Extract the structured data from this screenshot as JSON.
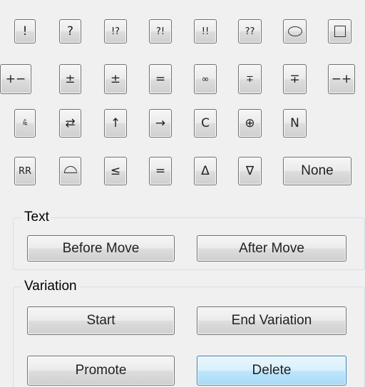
{
  "annotation_buttons": {
    "row1": [
      "!",
      "?",
      "!?",
      "?!",
      "!!",
      "??",
      "circle",
      "square"
    ],
    "row2": [
      "+−",
      "±",
      "±",
      "=",
      "∞",
      "∓",
      "∓",
      "−+"
    ],
    "row3": [
      "⩯",
      "⇄",
      "↑",
      "→",
      "C",
      "⊕",
      "N"
    ],
    "row4": [
      "RR",
      "arc",
      "≤",
      "=",
      "Δ",
      "∇"
    ],
    "none_label": "None"
  },
  "icons": {
    "row1_circle": "circle-icon",
    "row1_square": "square-icon",
    "row4_arc": "arc-icon"
  },
  "text_group": {
    "title": "Text",
    "before_move_label": "Before Move",
    "after_move_label": "After Move"
  },
  "variation_group": {
    "title": "Variation",
    "start_label": "Start",
    "end_variation_label": "End Variation",
    "promote_label": "Promote",
    "delete_label": "Delete"
  },
  "colors": {
    "background": "#f0f0f0",
    "active_button_fill": "#bee6fd",
    "active_button_border": "#3c7fb1"
  }
}
